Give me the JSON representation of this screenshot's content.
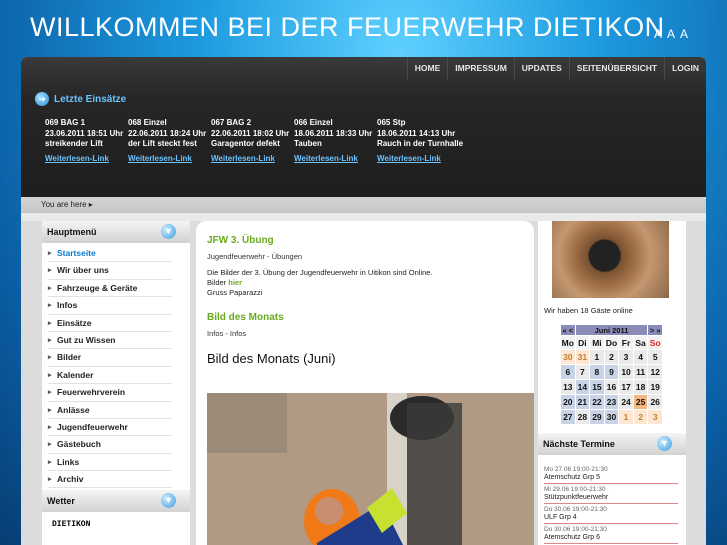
{
  "header": {
    "site_title": "WILLKOMMEN BEI DER FEUERWEHR DIETIKON",
    "font_sizes": [
      "A",
      "A",
      "A"
    ]
  },
  "nav": [
    "HOME",
    "IMPRESSUM",
    "UPDATES",
    "SEITENÜBERSICHT",
    "LOGIN"
  ],
  "latest": {
    "title": "Letzte Einsätze",
    "items": [
      {
        "l1": "069  BAG 1",
        "l2": "23.06.2011  18:51 Uhr",
        "l3": "streikender Lift",
        "link": "Weiterlesen-Link"
      },
      {
        "l1": "068  Einzel",
        "l2": "22.06.2011  18:24 Uhr",
        "l3": "der Lift steckt fest",
        "link": "Weiterlesen-Link"
      },
      {
        "l1": "067  BAG 2",
        "l2": "22.06.2011  18:02 Uhr",
        "l3": "Garagentor defekt",
        "link": "Weiterlesen-Link"
      },
      {
        "l1": "066  Einzel",
        "l2": "18.06.2011  18:33 Uhr",
        "l3": "Tauben",
        "link": "Weiterlesen-Link"
      },
      {
        "l1": "065  Stp",
        "l2": "18.06.2011  14:13 Uhr",
        "l3": "Rauch in der Turnhalle",
        "link": "Weiterlesen-Link"
      }
    ]
  },
  "breadcrumb": "You are here",
  "left": {
    "menu_title": "Hauptmenü",
    "items": [
      "Startseite",
      "Wir über uns",
      "Fahrzeuge & Geräte",
      "Infos",
      "Einsätze",
      "Gut zu Wissen",
      "Bilder",
      "Kalender",
      "Feuerwehrverein",
      "Anlässe",
      "Jugendfeuerwehr",
      "Gästebuch",
      "Links",
      "Archiv"
    ],
    "weather_title": "Wetter",
    "weather_text": "DIETIKON"
  },
  "main": {
    "a1_title": "JFW 3. Übung",
    "a1_sub": "Jugendfeuerwehr - Übungen",
    "a1_p1": "Die Bilder der 3. Übung der Jugendfeuerwehr in Uitikon sind Online.",
    "a1_p2a": "Bilder ",
    "a1_p2b": "hier",
    "a1_p3": "Gruss Paparazzi",
    "a2_title": "Bild des Monats",
    "a2_sub": "Infos - Infos",
    "a3_title": "Bild des Monats (Juni)"
  },
  "right": {
    "guests": "Wir haben 18 Gäste online",
    "cal_month": "Juni 2011",
    "cal_prev": "« <",
    "cal_next": "> »",
    "days": [
      "Mo",
      "Di",
      "Mi",
      "Do",
      "Fr",
      "Sa",
      "So"
    ],
    "weeks": [
      [
        "30",
        "31",
        "1",
        "2",
        "3",
        "4",
        "5"
      ],
      [
        "6",
        "7",
        "8",
        "9",
        "10",
        "11",
        "12"
      ],
      [
        "13",
        "14",
        "15",
        "16",
        "17",
        "18",
        "19"
      ],
      [
        "20",
        "21",
        "22",
        "23",
        "24",
        "25",
        "26"
      ],
      [
        "27",
        "28",
        "29",
        "30",
        "1",
        "2",
        "3"
      ]
    ],
    "termine_title": "Nächste Termine",
    "termine": [
      {
        "d": "Mo 27.06 19:00-21:30",
        "n": "Atemschutz Grp 5"
      },
      {
        "d": "Mi 29.06 19:00-21:30",
        "n": "Stützpunktfeuerwehr"
      },
      {
        "d": "Do 30.06 19:00-21:30",
        "n": "ULF Grp 4"
      },
      {
        "d": "Do 30.06 19:00-21:30",
        "n": "Atemschutz Grp 6"
      }
    ]
  }
}
